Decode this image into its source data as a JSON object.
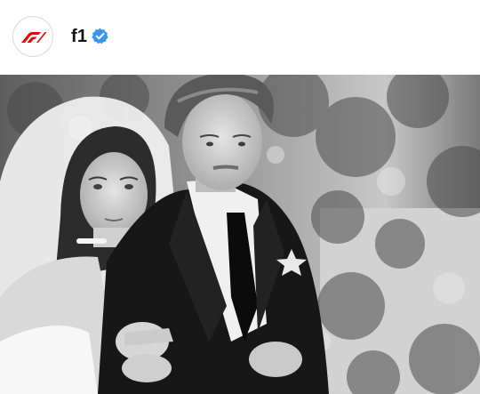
{
  "post_header": {
    "username": "f1",
    "avatar_logo": "f1-logo-icon",
    "verified_badge": "verified-badge-icon",
    "accent_color": "#e10600",
    "badge_color": "#3897f0"
  },
  "post_image": {
    "style": "black-and-white photograph"
  }
}
